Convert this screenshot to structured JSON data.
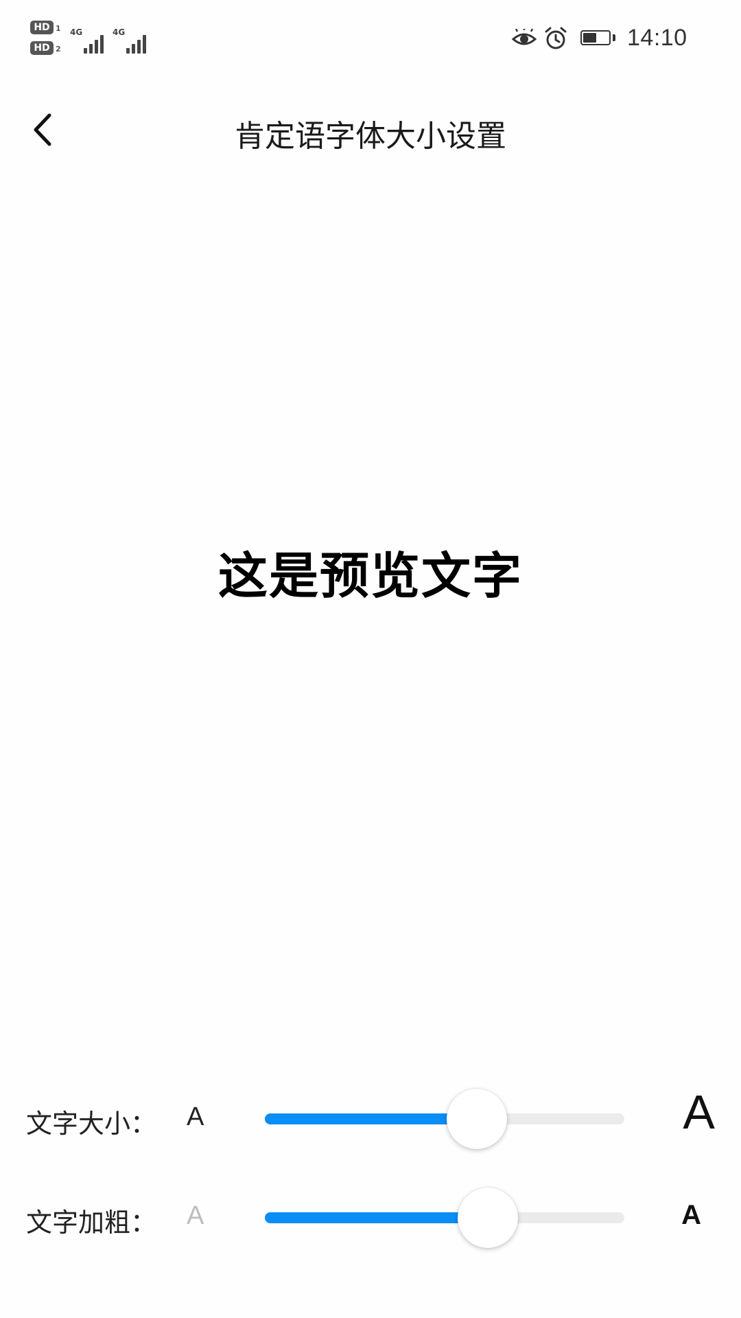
{
  "status_bar": {
    "hd_label": "HD",
    "sim1_sub": "1",
    "sim2_sub": "2",
    "network1": "4G",
    "network2": "4G",
    "time": "14:10",
    "battery_level": 0.55
  },
  "nav": {
    "title": "肯定语字体大小设置"
  },
  "preview": {
    "text": "这是预览文字"
  },
  "settings": {
    "size": {
      "label": "文字大小：",
      "min_label": "A",
      "max_label": "A",
      "value": 0.59
    },
    "bold": {
      "label": "文字加粗：",
      "min_label": "A",
      "max_label": "A",
      "value": 0.62
    }
  },
  "colors": {
    "accent": "#0a8df5",
    "track": "#ebebeb"
  }
}
